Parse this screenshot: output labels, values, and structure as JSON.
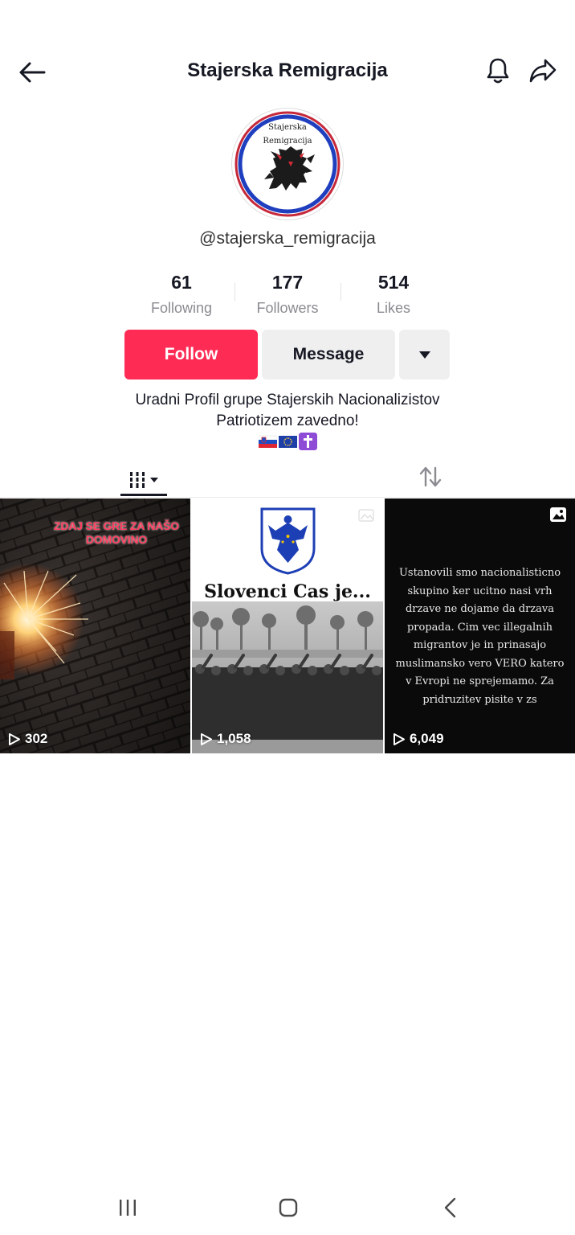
{
  "header": {
    "title": "Stajerska Remigracija",
    "back_icon": "arrow-left-icon",
    "bell_icon": "bell-icon",
    "share_icon": "share-icon"
  },
  "profile": {
    "avatar_line1": "Stajerska",
    "avatar_line2": "Remigracija",
    "username": "@stajerska_remigracija"
  },
  "stats": [
    {
      "value": "61",
      "label": "Following"
    },
    {
      "value": "177",
      "label": "Followers"
    },
    {
      "value": "514",
      "label": "Likes"
    }
  ],
  "actions": {
    "follow_label": "Follow",
    "message_label": "Message",
    "more_icon": "caret-down-icon"
  },
  "bio": {
    "line1": "Uradni Profil grupe Stajerskih Nacionalizistov",
    "line2": "Patriotizem zavedno!",
    "emojis": [
      "slovenia-flag",
      "eu-flag",
      "cross-emoji"
    ]
  },
  "tabs": {
    "videos_icon": "grid-icon",
    "reposts_icon": "repost-icon"
  },
  "videos": [
    {
      "views": "302",
      "caption": "ZDAJ SE GRE ZA NAŠO DOMOVINO"
    },
    {
      "views": "1,058",
      "caption": "Slovenci Cas je..."
    },
    {
      "views": "6,049",
      "caption": "Ustanovili smo nacionalisticno skupino ker ucitno nasi vrh drzave ne dojame da drzava propada. Cim vec illegalnih migrantov je in prinasajo muslimansko vero VERO katero v Evropi ne sprejemamo. Za pridruzitev pisite v zs"
    }
  ],
  "colors": {
    "accent": "#fe2c55",
    "text": "#161823",
    "muted": "#8a8b91",
    "button_gray": "#efefef"
  }
}
